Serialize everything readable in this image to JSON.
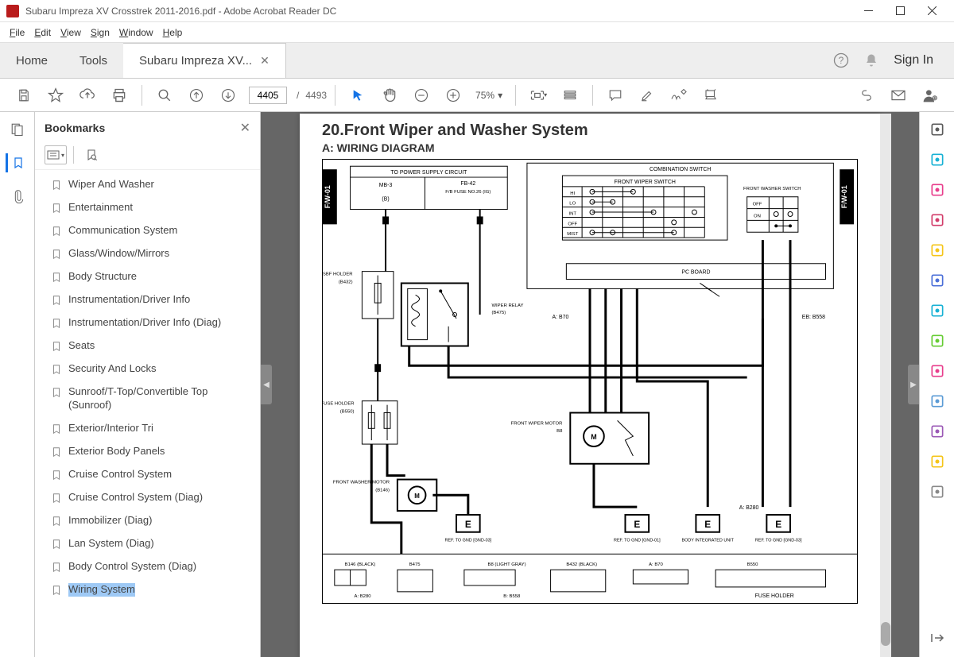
{
  "window": {
    "title": "Subaru Impreza XV Crosstrek 2011-2016.pdf - Adobe Acrobat Reader DC"
  },
  "menu": [
    "File",
    "Edit",
    "View",
    "Sign",
    "Window",
    "Help"
  ],
  "tabs": {
    "home": "Home",
    "tools": "Tools",
    "doc": "Subaru Impreza XV...",
    "signin": "Sign In"
  },
  "toolbar": {
    "page_current": "4405",
    "page_sep": "/",
    "page_total": "4493",
    "zoom": "75%"
  },
  "bookmarks": {
    "title": "Bookmarks",
    "items": [
      "Wiper And Washer",
      "Entertainment",
      "Communication System",
      "Glass/Window/Mirrors",
      "Body Structure",
      "Instrumentation/Driver Info",
      "Instrumentation/Driver Info (Diag)",
      "Seats",
      "Security And Locks",
      "Sunroof/T-Top/Convertible Top (Sunroof)",
      "Exterior/Interior Tri",
      "Exterior Body Panels",
      "Cruise Control System",
      "Cruise Control System (Diag)",
      "Immobilizer (Diag)",
      "Lan System (Diag)",
      "Body Control System (Diag)",
      "Wiring System"
    ],
    "selected_index": 17
  },
  "document": {
    "heading": "20.Front Wiper and Washer System",
    "subheading": "A:  WIRING DIAGRAM",
    "labels": {
      "fw01": "F/W-01",
      "power_supply": "TO POWER SUPPLY CIRCUIT",
      "mb3": "MB-3",
      "b": "(B)",
      "fb42": "FB-42",
      "fb_fuse": "F/B FUSE NO.26 (IG)",
      "comb_switch": "COMBINATION SWITCH",
      "front_wiper_switch": "FRONT WIPER SWITCH",
      "rows": [
        "HI",
        "LO",
        "INT",
        "OFF",
        "MIST"
      ],
      "front_washer_switch": "FRONT WASHER SWITCH",
      "off": "OFF",
      "on": "ON",
      "pc_board": "PC BOARD",
      "sbf_holder": "SBF HOLDER",
      "b432": "B432",
      "wiper_relay": "WIPER RELAY",
      "b475": "B475",
      "a_b70": "A: B70",
      "eb_b558": "EB: B558",
      "fuse_holder": "FUSE HOLDER",
      "b550": "B550",
      "front_wiper_motor": "FRONT WIPER MOTOR",
      "b8": "B8",
      "front_washer_motor": "FRONT WASHER MOTOR",
      "b146": "B146",
      "ref_gnd03": "REF. TO GND [GND-03]",
      "ref_gnd01": "REF. TO GND [GND-01]",
      "body_int": "BODY INTEGRATED UNIT",
      "a_b280": "A: B280",
      "conn_b146": "B146",
      "conn_b475": "B475",
      "conn_b8": "B8 (LIGHT GRAY)",
      "conn_b432": "B432 (BLACK)",
      "conn_a_b70": "A: B70",
      "conn_b550": "B550",
      "conn_a_b280": "A: B280",
      "conn_b_b558": "B: B558",
      "fuse_holder2": "FUSE HOLDER"
    }
  },
  "right_tools_colors": [
    "#5b5b5b",
    "#17b1d4",
    "#e83e8c",
    "#d23c6a",
    "#f5c518",
    "#4b6fd8",
    "#17b1d4",
    "#66cc33",
    "#e83e8c",
    "#5b9bd5",
    "#9b59b6",
    "#f5c518",
    "#888"
  ]
}
